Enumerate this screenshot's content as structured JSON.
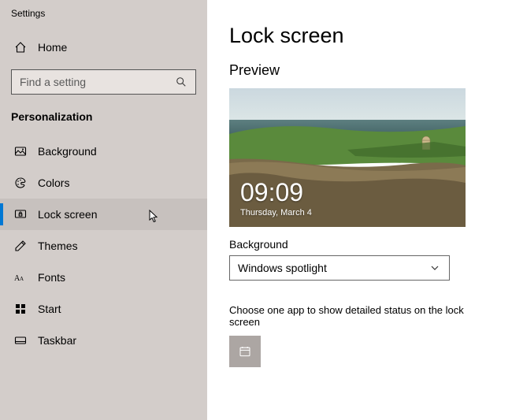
{
  "app_title": "Settings",
  "home_label": "Home",
  "search": {
    "placeholder": "Find a setting"
  },
  "category": "Personalization",
  "sidebar": {
    "items": [
      {
        "label": "Background"
      },
      {
        "label": "Colors"
      },
      {
        "label": "Lock screen"
      },
      {
        "label": "Themes"
      },
      {
        "label": "Fonts"
      },
      {
        "label": "Start"
      },
      {
        "label": "Taskbar"
      }
    ]
  },
  "page": {
    "title": "Lock screen",
    "preview_label": "Preview",
    "preview": {
      "time": "09:09",
      "date": "Thursday, March 4"
    },
    "background_label": "Background",
    "background_value": "Windows spotlight",
    "status_app_help": "Choose one app to show detailed status on the lock screen"
  }
}
